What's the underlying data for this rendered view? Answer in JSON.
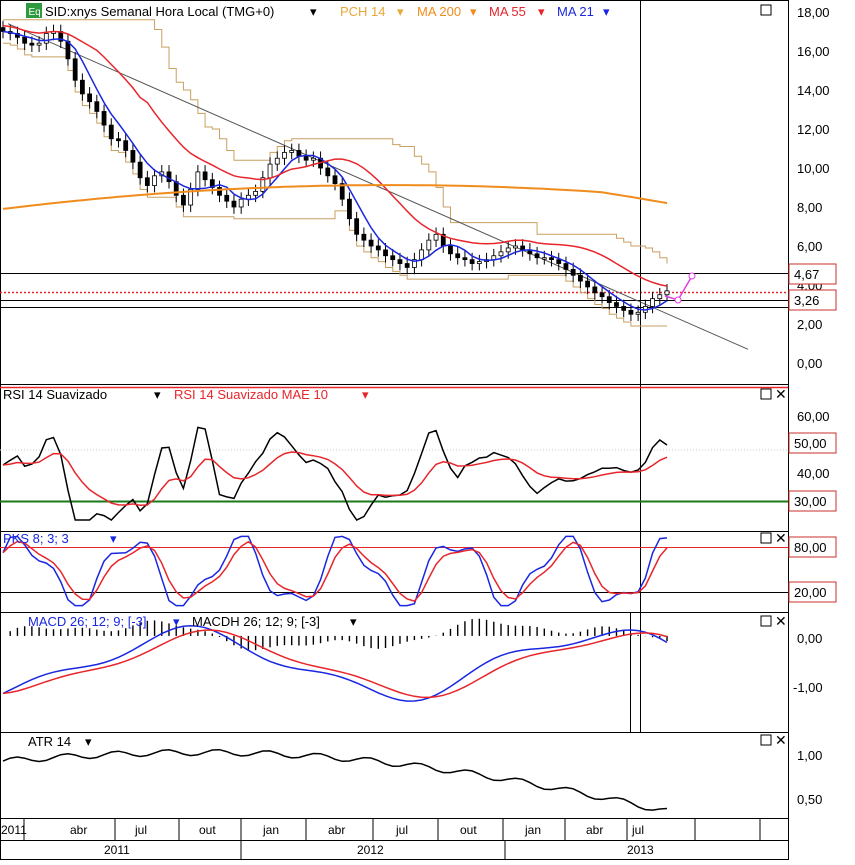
{
  "header": {
    "eq_badge": "Eq",
    "symbol_label": "SID:xnys Semanal Hora Local (TMG+0)",
    "indicators": [
      {
        "label": "PCH 14",
        "color": "#e8a838"
      },
      {
        "label": "MA 200",
        "color": "#f08c1c"
      },
      {
        "label": "MA 55",
        "color": "#e8252b"
      },
      {
        "label": "MA 21",
        "color": "#1a27e0"
      }
    ]
  },
  "colors": {
    "price_candles": "#000000",
    "pch": "#c8a060",
    "ma200": "#f08c1c",
    "ma55": "#e8252b",
    "ma21": "#1a27e0",
    "trendline": "#555555",
    "projection": "#e040e0",
    "rsi": "#000000",
    "rsi_mae": "#e8252b",
    "level30": "#1a7a1a",
    "pks_k": "#1a27e0",
    "pks_d": "#e8252b",
    "macd": "#1a27e0",
    "macd_signal": "#e8252b",
    "atr": "#000000",
    "badge_red": "#c8302c"
  },
  "price_panel": {
    "y_ticks": [
      "18,00",
      "16,00",
      "14,00",
      "12,00",
      "10,00",
      "8,00",
      "6,00",
      "4,00",
      "2,00",
      "0,00"
    ],
    "badge_high": "4,67",
    "badge_low": "3,26"
  },
  "rsi_panel": {
    "legend": [
      "RSI 14 Suavizado",
      "RSI 14 Suavizado MAE 10"
    ],
    "y_ticks": [
      "60,00",
      "50,00",
      "40,00",
      "30,00"
    ],
    "badges": [
      "50,00",
      "30,00"
    ]
  },
  "pks_panel": {
    "legend": "PKS 8; 3; 3",
    "badges": [
      "80,00",
      "20,00"
    ]
  },
  "macd_panel": {
    "legend": [
      "MACD 26; 12; 9; [-3]",
      "MACDH 26; 12; 9; [-3]"
    ],
    "y_ticks": [
      "0,00",
      "-1,00"
    ]
  },
  "atr_panel": {
    "legend": "ATR 14",
    "y_ticks": [
      "1,00",
      "0,50"
    ]
  },
  "time_axis": {
    "months": [
      "2011",
      "abr",
      "jul",
      "out",
      "jan",
      "abr",
      "jul",
      "out",
      "jan",
      "abr",
      "jul"
    ],
    "years": [
      "2011",
      "2012",
      "2013"
    ]
  },
  "chart_data": [
    {
      "type": "line",
      "name": "SID:xnys Semanal Hora Local (TMG+0)",
      "x_range": [
        "2011-01",
        "2013-08"
      ],
      "ylim": [
        -0.8,
        18.8
      ],
      "close_approx": [
        17.0,
        16.9,
        16.7,
        16.4,
        16.3,
        16.4,
        16.9,
        17.0,
        16.5,
        15.6,
        14.5,
        13.8,
        13.4,
        12.9,
        12.2,
        11.5,
        11.4,
        10.9,
        10.3,
        9.5,
        9.1,
        9.6,
        9.8,
        9.3,
        8.6,
        8.1,
        8.9,
        9.8,
        9.4,
        9.0,
        8.6,
        8.3,
        8.0,
        8.4,
        8.6,
        8.8,
        9.5,
        10.2,
        10.5,
        10.8,
        10.9,
        10.6,
        10.4,
        10.5,
        10.0,
        9.6,
        9.2,
        8.4,
        7.4,
        6.6,
        6.3,
        6.0,
        5.8,
        5.5,
        5.3,
        5.1,
        4.9,
        5.3,
        5.8,
        6.3,
        6.6,
        6.0,
        5.6,
        5.4,
        5.3,
        5.1,
        5.2,
        5.3,
        5.5,
        5.7,
        5.9,
        6.0,
        5.8,
        5.6,
        5.4,
        5.4,
        5.3,
        5.1,
        4.8,
        4.5,
        4.2,
        3.9,
        3.6,
        3.4,
        3.1,
        2.9,
        2.7,
        2.5,
        2.6,
        2.9,
        3.3,
        3.5,
        3.7
      ]
    },
    {
      "type": "line",
      "name": "MA 21",
      "y_range": [
        3.4,
        17.5
      ]
    },
    {
      "type": "line",
      "name": "MA 55",
      "y_range": [
        4.67,
        17.0
      ]
    },
    {
      "type": "line",
      "name": "MA 200",
      "y_range": [
        7.9,
        10.4
      ]
    },
    {
      "type": "line",
      "name": "RSI 14 Suavizado",
      "y_ticks": [
        60,
        50,
        40,
        30
      ]
    },
    {
      "type": "line",
      "name": "PKS 8; 3; 3",
      "levels": [
        80,
        20
      ]
    },
    {
      "type": "line",
      "name": "MACD 26; 12; 9; [-3]",
      "y_ticks": [
        0,
        -1
      ]
    },
    {
      "type": "line",
      "name": "ATR 14",
      "y_ticks": [
        1.0,
        0.5
      ]
    }
  ]
}
